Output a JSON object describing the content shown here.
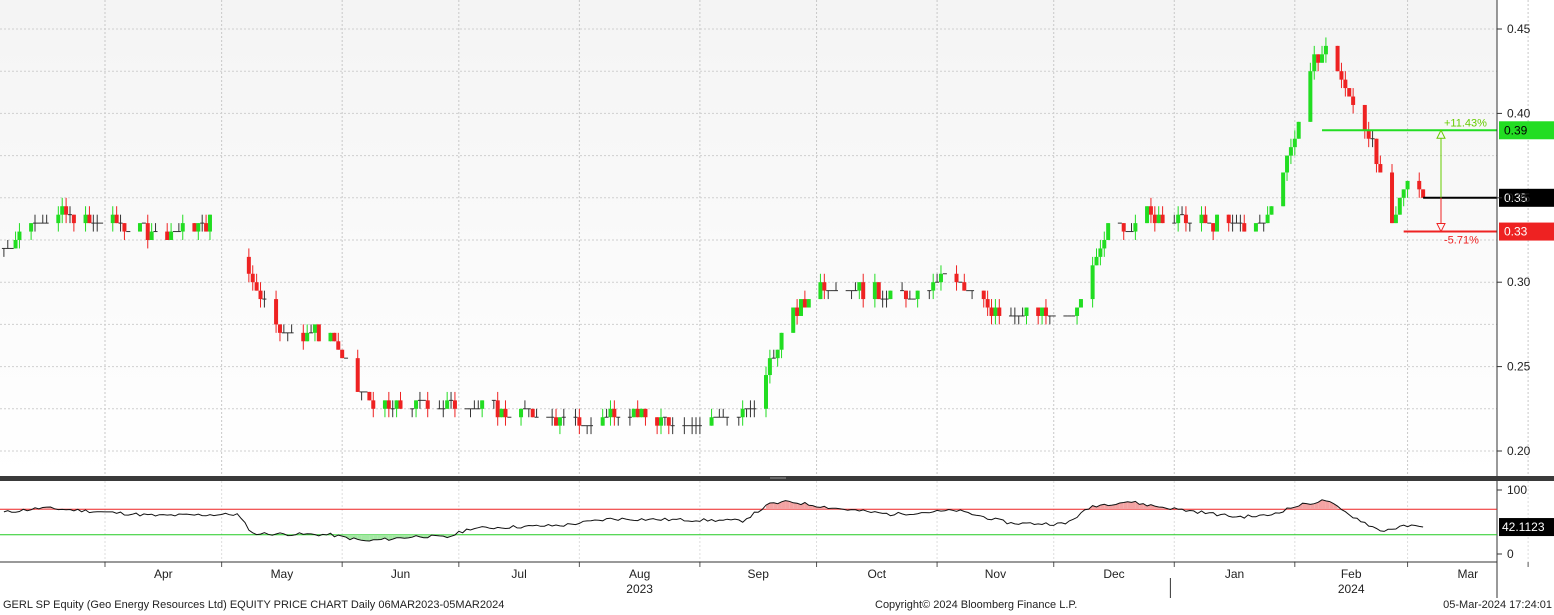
{
  "chart_data": [
    {
      "type": "candlestick",
      "panel": "price",
      "y_axis_side": "right",
      "ylim": [
        0.185,
        0.465
      ],
      "y_ticks": [
        "0.20",
        "0.25",
        "0.30",
        "0.35",
        "0.40",
        "0.45"
      ],
      "grid": true,
      "colors": {
        "up": "#22dd22",
        "down": "#ee2222",
        "neutral": "#333333"
      },
      "x_months": [
        "Apr",
        "May",
        "Jun",
        "Jul",
        "Aug",
        "Sep",
        "Oct",
        "Nov",
        "Dec",
        "Jan",
        "Feb",
        "Mar"
      ],
      "x_year_labels": [
        {
          "month": "Aug",
          "year": "2023"
        },
        {
          "month": "Feb",
          "year": "2024"
        }
      ],
      "reference_lines": [
        {
          "value": 0.39,
          "label": "0.39",
          "color": "#22dd22",
          "change_label": "+11.43%"
        },
        {
          "value": 0.35,
          "label": "0.35",
          "color": "#000000"
        },
        {
          "value": 0.33,
          "label": "0.33",
          "color": "#ee2222",
          "change_label": "-5.71%"
        }
      ],
      "approximate_close_path": [
        {
          "date": "2023-03-06",
          "close": 0.32
        },
        {
          "date": "2023-03-13",
          "close": 0.335
        },
        {
          "date": "2023-03-20",
          "close": 0.34
        },
        {
          "date": "2023-03-31",
          "close": 0.335
        },
        {
          "date": "2023-04-14",
          "close": 0.33
        },
        {
          "date": "2023-04-28",
          "close": 0.335
        },
        {
          "date": "2023-05-09",
          "close": 0.3
        },
        {
          "date": "2023-05-17",
          "close": 0.27
        },
        {
          "date": "2023-05-29",
          "close": 0.27
        },
        {
          "date": "2023-06-05",
          "close": 0.235
        },
        {
          "date": "2023-06-13",
          "close": 0.225
        },
        {
          "date": "2023-06-23",
          "close": 0.23
        },
        {
          "date": "2023-07-05",
          "close": 0.226
        },
        {
          "date": "2023-07-19",
          "close": 0.222
        },
        {
          "date": "2023-08-02",
          "close": 0.215
        },
        {
          "date": "2023-08-11",
          "close": 0.225
        },
        {
          "date": "2023-08-25",
          "close": 0.215
        },
        {
          "date": "2023-09-08",
          "close": 0.22
        },
        {
          "date": "2023-09-15",
          "close": 0.225
        },
        {
          "date": "2023-09-22",
          "close": 0.27
        },
        {
          "date": "2023-10-02",
          "close": 0.3
        },
        {
          "date": "2023-10-13",
          "close": 0.295
        },
        {
          "date": "2023-10-27",
          "close": 0.29
        },
        {
          "date": "2023-11-03",
          "close": 0.305
        },
        {
          "date": "2023-11-15",
          "close": 0.285
        },
        {
          "date": "2023-11-28",
          "close": 0.28
        },
        {
          "date": "2023-12-06",
          "close": 0.28
        },
        {
          "date": "2023-12-15",
          "close": 0.33
        },
        {
          "date": "2023-12-25",
          "close": 0.34
        },
        {
          "date": "2024-01-10",
          "close": 0.335
        },
        {
          "date": "2024-01-24",
          "close": 0.335
        },
        {
          "date": "2024-01-31",
          "close": 0.38
        },
        {
          "date": "2024-02-06",
          "close": 0.43
        },
        {
          "date": "2024-02-09",
          "close": 0.44
        },
        {
          "date": "2024-02-15",
          "close": 0.41
        },
        {
          "date": "2024-02-20",
          "close": 0.39
        },
        {
          "date": "2024-02-26",
          "close": 0.33
        },
        {
          "date": "2024-03-01",
          "close": 0.365
        },
        {
          "date": "2024-03-05",
          "close": 0.35
        }
      ]
    },
    {
      "type": "line",
      "panel": "indicator",
      "y_axis_side": "right",
      "ylim": [
        -10,
        110
      ],
      "y_ticks": [
        "0",
        "100"
      ],
      "thresholds": [
        {
          "value": 70,
          "color": "#ee2222"
        },
        {
          "value": 30,
          "color": "#22cc22"
        }
      ],
      "current_value": "42.1123",
      "approximate_values": [
        {
          "date": "2023-03-06",
          "value": 65
        },
        {
          "date": "2023-03-16",
          "value": 72
        },
        {
          "date": "2023-04-14",
          "value": 60
        },
        {
          "date": "2023-05-05",
          "value": 62
        },
        {
          "date": "2023-05-09",
          "value": 32
        },
        {
          "date": "2023-05-29",
          "value": 30
        },
        {
          "date": "2023-06-07",
          "value": 20
        },
        {
          "date": "2023-06-21",
          "value": 28
        },
        {
          "date": "2023-06-28",
          "value": 26
        },
        {
          "date": "2023-07-04",
          "value": 40
        },
        {
          "date": "2023-07-28",
          "value": 45
        },
        {
          "date": "2023-08-09",
          "value": 55
        },
        {
          "date": "2023-09-12",
          "value": 52
        },
        {
          "date": "2023-09-19",
          "value": 78
        },
        {
          "date": "2023-09-24",
          "value": 82
        },
        {
          "date": "2023-10-05",
          "value": 72
        },
        {
          "date": "2023-10-20",
          "value": 62
        },
        {
          "date": "2023-11-06",
          "value": 68
        },
        {
          "date": "2023-11-20",
          "value": 48
        },
        {
          "date": "2023-12-04",
          "value": 47
        },
        {
          "date": "2023-12-11",
          "value": 75
        },
        {
          "date": "2023-12-20",
          "value": 82
        },
        {
          "date": "2023-12-29",
          "value": 73
        },
        {
          "date": "2024-01-17",
          "value": 58
        },
        {
          "date": "2024-01-25",
          "value": 60
        },
        {
          "date": "2024-02-02",
          "value": 76
        },
        {
          "date": "2024-02-09",
          "value": 84
        },
        {
          "date": "2024-02-14",
          "value": 65
        },
        {
          "date": "2024-02-23",
          "value": 36
        },
        {
          "date": "2024-03-01",
          "value": 44
        },
        {
          "date": "2024-03-05",
          "value": 42.1123
        }
      ]
    }
  ],
  "footer": {
    "left": "GERL SP Equity (Geo Energy Resources Ltd) EQUITY PRICE CHART  Daily 06MAR2023-05MAR2024",
    "center": "Copyright© 2024 Bloomberg Finance L.P.",
    "right": "05-Mar-2024 17:24:01"
  }
}
